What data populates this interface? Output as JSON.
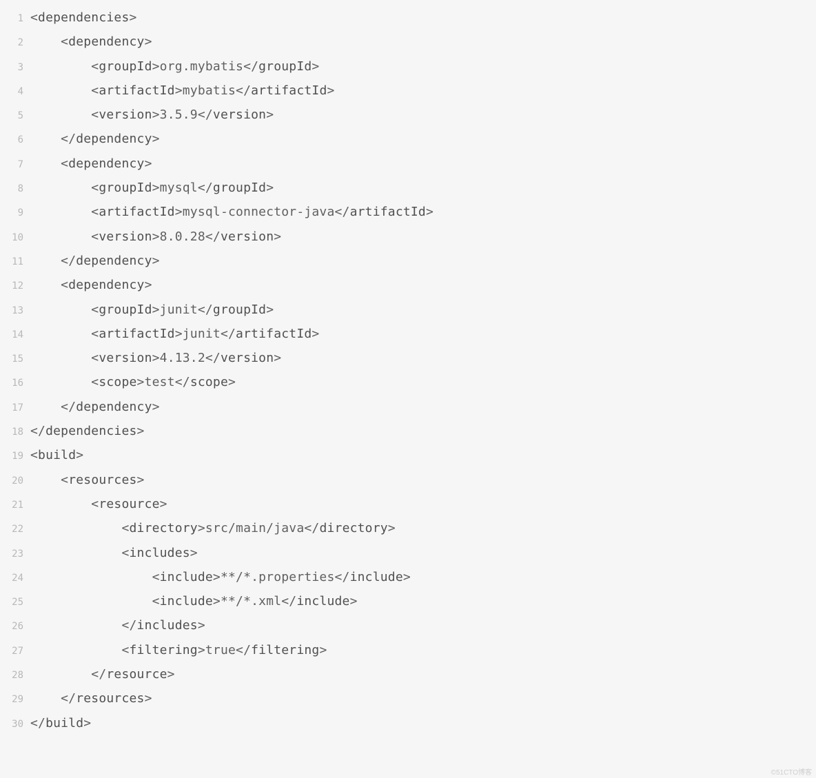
{
  "watermark": "©51CTO博客",
  "lines": [
    {
      "n": 1,
      "indent": 0,
      "tokens": [
        [
          "<",
          "p"
        ],
        [
          "dependencies",
          "t"
        ],
        [
          ">",
          "p"
        ]
      ]
    },
    {
      "n": 2,
      "indent": 1,
      "tokens": [
        [
          "<",
          "p"
        ],
        [
          "dependency",
          "t"
        ],
        [
          ">",
          "p"
        ]
      ]
    },
    {
      "n": 3,
      "indent": 2,
      "tokens": [
        [
          "<",
          "p"
        ],
        [
          "groupId",
          "t"
        ],
        [
          ">",
          "p"
        ],
        [
          "org.mybatis",
          "v"
        ],
        [
          "</",
          "p"
        ],
        [
          "groupId",
          "t"
        ],
        [
          ">",
          "p"
        ]
      ]
    },
    {
      "n": 4,
      "indent": 2,
      "tokens": [
        [
          "<",
          "p"
        ],
        [
          "artifactId",
          "t"
        ],
        [
          ">",
          "p"
        ],
        [
          "mybatis",
          "v"
        ],
        [
          "</",
          "p"
        ],
        [
          "artifactId",
          "t"
        ],
        [
          ">",
          "p"
        ]
      ]
    },
    {
      "n": 5,
      "indent": 2,
      "tokens": [
        [
          "<",
          "p"
        ],
        [
          "version",
          "t"
        ],
        [
          ">",
          "p"
        ],
        [
          "3.5.9",
          "v"
        ],
        [
          "</",
          "p"
        ],
        [
          "version",
          "t"
        ],
        [
          ">",
          "p"
        ]
      ]
    },
    {
      "n": 6,
      "indent": 1,
      "tokens": [
        [
          "</",
          "p"
        ],
        [
          "dependency",
          "t"
        ],
        [
          ">",
          "p"
        ]
      ]
    },
    {
      "n": 7,
      "indent": 1,
      "tokens": [
        [
          "<",
          "p"
        ],
        [
          "dependency",
          "t"
        ],
        [
          ">",
          "p"
        ]
      ]
    },
    {
      "n": 8,
      "indent": 2,
      "tokens": [
        [
          "<",
          "p"
        ],
        [
          "groupId",
          "t"
        ],
        [
          ">",
          "p"
        ],
        [
          "mysql",
          "v"
        ],
        [
          "</",
          "p"
        ],
        [
          "groupId",
          "t"
        ],
        [
          ">",
          "p"
        ]
      ]
    },
    {
      "n": 9,
      "indent": 2,
      "tokens": [
        [
          "<",
          "p"
        ],
        [
          "artifactId",
          "t"
        ],
        [
          ">",
          "p"
        ],
        [
          "mysql-connector-java",
          "v"
        ],
        [
          "</",
          "p"
        ],
        [
          "artifactId",
          "t"
        ],
        [
          ">",
          "p"
        ]
      ]
    },
    {
      "n": 10,
      "indent": 2,
      "tokens": [
        [
          "<",
          "p"
        ],
        [
          "version",
          "t"
        ],
        [
          ">",
          "p"
        ],
        [
          "8.0.28",
          "v"
        ],
        [
          "</",
          "p"
        ],
        [
          "version",
          "t"
        ],
        [
          ">",
          "p"
        ]
      ]
    },
    {
      "n": 11,
      "indent": 1,
      "tokens": [
        [
          "</",
          "p"
        ],
        [
          "dependency",
          "t"
        ],
        [
          ">",
          "p"
        ]
      ]
    },
    {
      "n": 12,
      "indent": 1,
      "tokens": [
        [
          "<",
          "p"
        ],
        [
          "dependency",
          "t"
        ],
        [
          ">",
          "p"
        ]
      ]
    },
    {
      "n": 13,
      "indent": 2,
      "tokens": [
        [
          "<",
          "p"
        ],
        [
          "groupId",
          "t"
        ],
        [
          ">",
          "p"
        ],
        [
          "junit",
          "v"
        ],
        [
          "</",
          "p"
        ],
        [
          "groupId",
          "t"
        ],
        [
          ">",
          "p"
        ]
      ]
    },
    {
      "n": 14,
      "indent": 2,
      "tokens": [
        [
          "<",
          "p"
        ],
        [
          "artifactId",
          "t"
        ],
        [
          ">",
          "p"
        ],
        [
          "junit",
          "v"
        ],
        [
          "</",
          "p"
        ],
        [
          "artifactId",
          "t"
        ],
        [
          ">",
          "p"
        ]
      ]
    },
    {
      "n": 15,
      "indent": 2,
      "tokens": [
        [
          "<",
          "p"
        ],
        [
          "version",
          "t"
        ],
        [
          ">",
          "p"
        ],
        [
          "4.13.2",
          "v"
        ],
        [
          "</",
          "p"
        ],
        [
          "version",
          "t"
        ],
        [
          ">",
          "p"
        ]
      ]
    },
    {
      "n": 16,
      "indent": 2,
      "tokens": [
        [
          "<",
          "p"
        ],
        [
          "scope",
          "t"
        ],
        [
          ">",
          "p"
        ],
        [
          "test",
          "v"
        ],
        [
          "</",
          "p"
        ],
        [
          "scope",
          "t"
        ],
        [
          ">",
          "p"
        ]
      ]
    },
    {
      "n": 17,
      "indent": 1,
      "tokens": [
        [
          "</",
          "p"
        ],
        [
          "dependency",
          "t"
        ],
        [
          ">",
          "p"
        ]
      ]
    },
    {
      "n": 18,
      "indent": 0,
      "tokens": [
        [
          "</",
          "p"
        ],
        [
          "dependencies",
          "t"
        ],
        [
          ">",
          "p"
        ]
      ]
    },
    {
      "n": 19,
      "indent": 0,
      "tokens": [
        [
          "<",
          "p"
        ],
        [
          "build",
          "t"
        ],
        [
          ">",
          "p"
        ]
      ]
    },
    {
      "n": 20,
      "indent": 1,
      "tokens": [
        [
          "<",
          "p"
        ],
        [
          "resources",
          "t"
        ],
        [
          ">",
          "p"
        ]
      ]
    },
    {
      "n": 21,
      "indent": 2,
      "tokens": [
        [
          "<",
          "p"
        ],
        [
          "resource",
          "t"
        ],
        [
          ">",
          "p"
        ]
      ]
    },
    {
      "n": 22,
      "indent": 3,
      "tokens": [
        [
          "<",
          "p"
        ],
        [
          "directory",
          "t"
        ],
        [
          ">",
          "p"
        ],
        [
          "src/main/java",
          "v"
        ],
        [
          "</",
          "p"
        ],
        [
          "directory",
          "t"
        ],
        [
          ">",
          "p"
        ]
      ]
    },
    {
      "n": 23,
      "indent": 3,
      "tokens": [
        [
          "<",
          "p"
        ],
        [
          "includes",
          "t"
        ],
        [
          ">",
          "p"
        ]
      ]
    },
    {
      "n": 24,
      "indent": 4,
      "tokens": [
        [
          "<",
          "p"
        ],
        [
          "include",
          "t"
        ],
        [
          ">",
          "p"
        ],
        [
          "**/*.properties",
          "v"
        ],
        [
          "</",
          "p"
        ],
        [
          "include",
          "t"
        ],
        [
          ">",
          "p"
        ]
      ]
    },
    {
      "n": 25,
      "indent": 4,
      "tokens": [
        [
          "<",
          "p"
        ],
        [
          "include",
          "t"
        ],
        [
          ">",
          "p"
        ],
        [
          "**/*.xml",
          "v"
        ],
        [
          "</",
          "p"
        ],
        [
          "include",
          "t"
        ],
        [
          ">",
          "p"
        ]
      ]
    },
    {
      "n": 26,
      "indent": 3,
      "tokens": [
        [
          "</",
          "p"
        ],
        [
          "includes",
          "t"
        ],
        [
          ">",
          "p"
        ]
      ]
    },
    {
      "n": 27,
      "indent": 3,
      "tokens": [
        [
          "<",
          "p"
        ],
        [
          "filtering",
          "t"
        ],
        [
          ">",
          "p"
        ],
        [
          "true",
          "v"
        ],
        [
          "</",
          "p"
        ],
        [
          "filtering",
          "t"
        ],
        [
          ">",
          "p"
        ]
      ]
    },
    {
      "n": 28,
      "indent": 2,
      "tokens": [
        [
          "</",
          "p"
        ],
        [
          "resource",
          "t"
        ],
        [
          ">",
          "p"
        ]
      ]
    },
    {
      "n": 29,
      "indent": 1,
      "tokens": [
        [
          "</",
          "p"
        ],
        [
          "resources",
          "t"
        ],
        [
          ">",
          "p"
        ]
      ]
    },
    {
      "n": 30,
      "indent": 0,
      "tokens": [
        [
          "</",
          "p"
        ],
        [
          "build",
          "t"
        ],
        [
          ">",
          "p"
        ]
      ]
    }
  ]
}
